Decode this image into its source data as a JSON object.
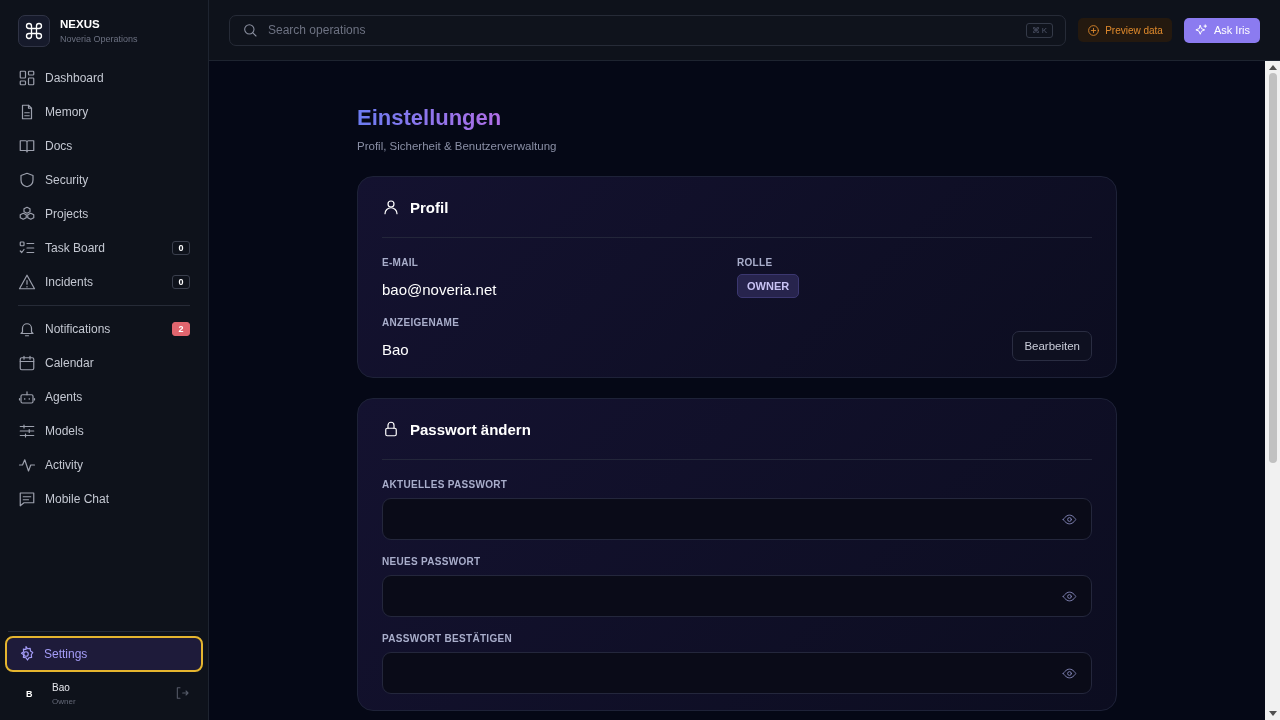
{
  "brand": {
    "name": "NEXUS",
    "subtitle": "Noveria Operations"
  },
  "nav_groups": [
    [
      {
        "label": "Dashboard",
        "selected": false
      },
      {
        "label": "Memory",
        "selected": false
      },
      {
        "label": "Docs",
        "selected": false
      },
      {
        "label": "Security",
        "selected": false
      },
      {
        "label": "Projects",
        "selected": false
      },
      {
        "label": "Task Board",
        "selected": false,
        "badge": "0",
        "unread": false
      },
      {
        "label": "Incidents",
        "selected": false,
        "badge": "0",
        "unread": false
      }
    ],
    [
      {
        "label": "Notifications",
        "selected": false,
        "badge": "2",
        "unread": true
      },
      {
        "label": "Calendar",
        "selected": false
      },
      {
        "label": "Agents",
        "selected": false
      },
      {
        "label": "Models",
        "selected": false
      },
      {
        "label": "Activity",
        "selected": false
      },
      {
        "label": "Mobile Chat",
        "selected": false
      }
    ]
  ],
  "settings_item": {
    "label": "Settings",
    "selected": true
  },
  "user": {
    "initial": "B",
    "name": "Bao",
    "role": "Owner"
  },
  "topbar": {
    "search_placeholder": "Search operations",
    "shortcut": "⌘ K",
    "preview_button": "Preview data",
    "ask_button": "Ask Iris"
  },
  "page": {
    "title": "Einstellungen",
    "subtitle": "Profil, Sicherheit & Benutzerverwaltung"
  },
  "profile_card": {
    "title": "Profil",
    "email_label": "E-MAIL",
    "email": "bao@noveria.net",
    "role_label": "ROLLE",
    "role": "OWNER",
    "display_name_label": "ANZEIGENAME",
    "display_name": "Bao",
    "edit_button": "Bearbeiten"
  },
  "password_card": {
    "title": "Passwort ändern",
    "fields": [
      {
        "label": "AKTUELLES PASSWORT"
      },
      {
        "label": "NEUES PASSWORT"
      },
      {
        "label": "PASSWORT BESTÄTIGEN"
      }
    ]
  }
}
